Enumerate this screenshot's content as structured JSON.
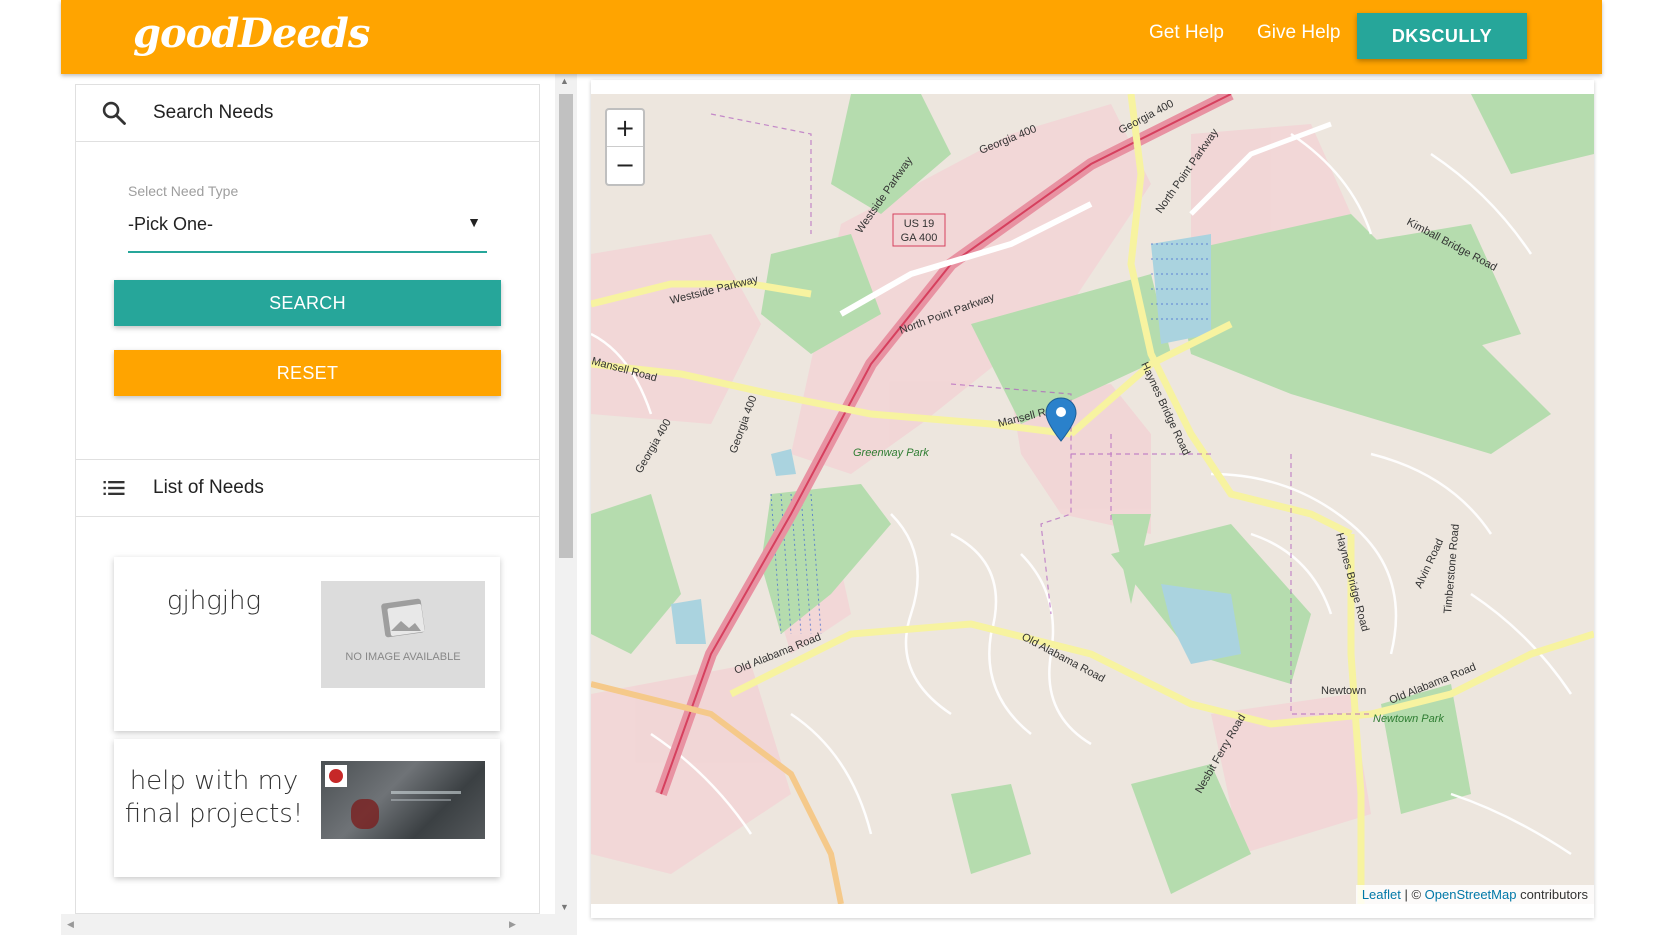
{
  "header": {
    "brand": "goodDeeds",
    "nav": {
      "get_help": "Get Help",
      "give_help": "Give Help"
    },
    "user_button": "DKSCULLY"
  },
  "colors": {
    "navbar": "#ffa400",
    "accent": "#26a69a",
    "reset": "#ffa400"
  },
  "sidebar": {
    "search_section": {
      "title": "Search Needs",
      "icon": "search-icon",
      "select_label": "Select Need Type",
      "select_value": "-Pick One-",
      "search_button": "SEARCH",
      "reset_button": "RESET"
    },
    "list_section": {
      "title": "List of Needs",
      "icon": "list-icon",
      "items": [
        {
          "title": "gjhgjhg",
          "image": "no-image-placeholder",
          "image_text": "NO IMAGE AVAILABLE"
        },
        {
          "title": "help with my final projects!",
          "image": "project-screenshot-thumbnail"
        }
      ]
    }
  },
  "map": {
    "labels": {
      "us19": "US 19",
      "ga400": "GA 400",
      "georgia400": "Georgia 400",
      "westside_pkwy": "Westside Parkway",
      "north_point_pkwy": "North Point Parkway",
      "mansell_road": "Mansell Road",
      "haynes_bridge": "Haynes Bridge Road",
      "old_alabama": "Old Alabama Road",
      "kimball_bridge": "Kimball Bridge Road",
      "greenway_park": "Greenway Park",
      "newtown": "Newtown",
      "newtown_park": "Newtown Park",
      "alvin_road": "Alvin Road",
      "timberstone": "Timberstone Road",
      "nesbit_ferry": "Nesbit Ferry Road"
    },
    "zoom_in": "+",
    "zoom_out": "−",
    "attribution": {
      "leaflet": "Leaflet",
      "sep": " | © ",
      "osm": "OpenStreetMap",
      "contrib": " contributors"
    }
  }
}
